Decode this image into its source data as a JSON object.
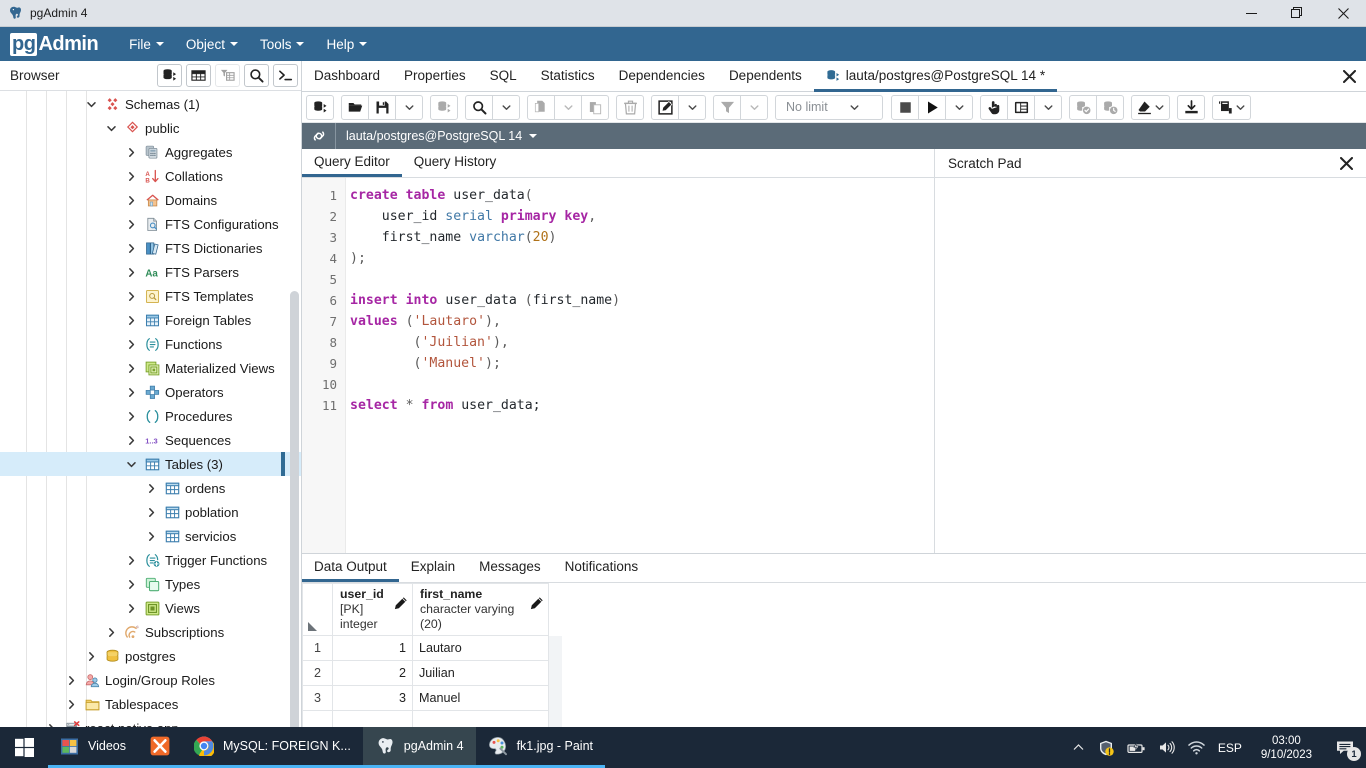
{
  "window": {
    "title": "pgAdmin 4",
    "icon": "pgadmin-elephant-icon",
    "minimize": "—",
    "restore": "❐",
    "close": "✕"
  },
  "menubar": {
    "brand_pg": "pg",
    "brand_admin": "Admin",
    "items": [
      {
        "label": "File"
      },
      {
        "label": "Object"
      },
      {
        "label": "Tools"
      },
      {
        "label": "Help"
      }
    ]
  },
  "browser": {
    "title": "Browser",
    "buttons": [
      {
        "name": "query-tool-button",
        "icon": "query-tool-icon",
        "enabled": true
      },
      {
        "name": "view-data-button",
        "icon": "grid-icon",
        "enabled": true
      },
      {
        "name": "filtered-rows-button",
        "icon": "filter-grid-icon",
        "enabled": false
      },
      {
        "name": "search-objects-button",
        "icon": "search-icon",
        "enabled": true
      },
      {
        "name": "psql-tool-button",
        "icon": "terminal-icon",
        "enabled": true
      }
    ],
    "tree": [
      {
        "label": "Schemas (1)",
        "icon": "schemas-icon",
        "indent": 4,
        "state": "open",
        "selected": false
      },
      {
        "label": "public",
        "icon": "schema-icon",
        "indent": 5,
        "state": "open",
        "selected": false
      },
      {
        "label": "Aggregates",
        "icon": "aggregates-icon",
        "indent": 6,
        "state": "closed",
        "selected": false
      },
      {
        "label": "Collations",
        "icon": "collations-icon",
        "indent": 6,
        "state": "closed",
        "selected": false
      },
      {
        "label": "Domains",
        "icon": "domains-icon",
        "indent": 6,
        "state": "closed",
        "selected": false
      },
      {
        "label": "FTS Configurations",
        "icon": "fts-configurations-icon",
        "indent": 6,
        "state": "closed",
        "selected": false
      },
      {
        "label": "FTS Dictionaries",
        "icon": "fts-dictionaries-icon",
        "indent": 6,
        "state": "closed",
        "selected": false
      },
      {
        "label": "FTS Parsers",
        "icon": "fts-parsers-icon",
        "indent": 6,
        "state": "closed",
        "selected": false
      },
      {
        "label": "FTS Templates",
        "icon": "fts-templates-icon",
        "indent": 6,
        "state": "closed",
        "selected": false
      },
      {
        "label": "Foreign Tables",
        "icon": "foreign-tables-icon",
        "indent": 6,
        "state": "closed",
        "selected": false
      },
      {
        "label": "Functions",
        "icon": "functions-icon",
        "indent": 6,
        "state": "closed",
        "selected": false
      },
      {
        "label": "Materialized Views",
        "icon": "materialized-views-icon",
        "indent": 6,
        "state": "closed",
        "selected": false
      },
      {
        "label": "Operators",
        "icon": "operators-icon",
        "indent": 6,
        "state": "closed",
        "selected": false
      },
      {
        "label": "Procedures",
        "icon": "procedures-icon",
        "indent": 6,
        "state": "closed",
        "selected": false
      },
      {
        "label": "Sequences",
        "icon": "sequences-icon",
        "indent": 6,
        "state": "closed",
        "selected": false
      },
      {
        "label": "Tables (3)",
        "icon": "tables-icon",
        "indent": 6,
        "state": "open",
        "selected": true
      },
      {
        "label": "ordens",
        "icon": "table-icon",
        "indent": 7,
        "state": "closed",
        "selected": false
      },
      {
        "label": "poblation",
        "icon": "table-icon",
        "indent": 7,
        "state": "closed",
        "selected": false
      },
      {
        "label": "servicios",
        "icon": "table-icon",
        "indent": 7,
        "state": "closed",
        "selected": false
      },
      {
        "label": "Trigger Functions",
        "icon": "trigger-functions-icon",
        "indent": 6,
        "state": "closed",
        "selected": false
      },
      {
        "label": "Types",
        "icon": "types-icon",
        "indent": 6,
        "state": "closed",
        "selected": false
      },
      {
        "label": "Views",
        "icon": "views-icon",
        "indent": 6,
        "state": "closed",
        "selected": false
      },
      {
        "label": "Subscriptions",
        "icon": "subscriptions-icon",
        "indent": 5,
        "state": "closed",
        "selected": false
      },
      {
        "label": "postgres",
        "icon": "database-icon",
        "indent": 4,
        "state": "closed",
        "selected": false
      },
      {
        "label": "Login/Group Roles",
        "icon": "roles-icon",
        "indent": 3,
        "state": "closed",
        "selected": false
      },
      {
        "label": "Tablespaces",
        "icon": "tablespaces-icon",
        "indent": 3,
        "state": "closed",
        "selected": false
      },
      {
        "label": "react native app",
        "icon": "server-disconnected-icon",
        "indent": 2,
        "state": "closed",
        "selected": false
      }
    ]
  },
  "object_tabs": {
    "tabs": [
      {
        "label": "Dashboard",
        "active": false,
        "icon": null
      },
      {
        "label": "Properties",
        "active": false,
        "icon": null
      },
      {
        "label": "SQL",
        "active": false,
        "icon": null
      },
      {
        "label": "Statistics",
        "active": false,
        "icon": null
      },
      {
        "label": "Dependencies",
        "active": false,
        "icon": null
      },
      {
        "label": "Dependents",
        "active": false,
        "icon": null
      },
      {
        "label": "lauta/postgres@PostgreSQL 14 *",
        "active": true,
        "icon": "database-tab-icon"
      }
    ],
    "close_icon": "close-icon"
  },
  "query_toolbar": {
    "groups": [
      {
        "buttons": [
          {
            "name": "open-query-tool-button",
            "icon": "query-tool-icon",
            "caret": false,
            "enabled": true
          }
        ]
      },
      {
        "buttons": [
          {
            "name": "open-file-button",
            "icon": "folder-open-icon",
            "caret": false,
            "enabled": true
          },
          {
            "name": "save-file-button",
            "icon": "save-icon",
            "caret": false,
            "enabled": true
          },
          {
            "name": "save-file-dropdown",
            "icon": null,
            "caret": true,
            "enabled": true
          }
        ]
      },
      {
        "buttons": [
          {
            "name": "view-data-button",
            "icon": "query-tool-icon",
            "caret": false,
            "enabled": false
          }
        ]
      },
      {
        "buttons": [
          {
            "name": "find-button",
            "icon": "search-icon",
            "caret": false,
            "enabled": true
          },
          {
            "name": "find-dropdown",
            "icon": null,
            "caret": true,
            "enabled": true
          }
        ]
      },
      {
        "buttons": [
          {
            "name": "copy-button",
            "icon": "copy-icon",
            "caret": false,
            "enabled": false
          },
          {
            "name": "copy-dropdown",
            "icon": null,
            "caret": true,
            "enabled": false
          },
          {
            "name": "paste-button",
            "icon": "paste-icon",
            "caret": false,
            "enabled": false
          }
        ]
      },
      {
        "buttons": [
          {
            "name": "delete-row-button",
            "icon": "trash-icon",
            "caret": false,
            "enabled": false
          }
        ]
      },
      {
        "buttons": [
          {
            "name": "edit-button",
            "icon": "edit-icon",
            "caret": false,
            "enabled": true
          },
          {
            "name": "edit-dropdown",
            "icon": null,
            "caret": true,
            "enabled": true
          }
        ]
      },
      {
        "buttons": [
          {
            "name": "filter-button",
            "icon": "funnel-icon",
            "caret": false,
            "enabled": false
          },
          {
            "name": "filter-dropdown",
            "icon": null,
            "caret": true,
            "enabled": false
          }
        ]
      }
    ],
    "limit": {
      "name": "row-limit-select",
      "value": "No limit"
    },
    "groups2": [
      {
        "buttons": [
          {
            "name": "stop-query-button",
            "icon": "stop-icon",
            "caret": false,
            "enabled": true
          },
          {
            "name": "execute-query-button",
            "icon": "play-icon",
            "caret": false,
            "enabled": true
          },
          {
            "name": "execute-dropdown",
            "icon": null,
            "caret": true,
            "enabled": true
          }
        ]
      },
      {
        "buttons": [
          {
            "name": "explain-button",
            "icon": "hand-pointer-icon",
            "caret": false,
            "enabled": true
          },
          {
            "name": "explain-analyze-button",
            "icon": "explain-panel-icon",
            "caret": false,
            "enabled": true
          },
          {
            "name": "explain-options-dropdown",
            "icon": null,
            "caret": true,
            "enabled": true
          }
        ]
      },
      {
        "buttons": [
          {
            "name": "commit-button",
            "icon": "commit-icon",
            "caret": false,
            "enabled": false
          },
          {
            "name": "rollback-button",
            "icon": "rollback-icon",
            "caret": false,
            "enabled": false
          }
        ]
      },
      {
        "buttons": [
          {
            "name": "clear-button",
            "icon": "eraser-icon",
            "caret": true,
            "enabled": true
          }
        ]
      },
      {
        "buttons": [
          {
            "name": "download-results-button",
            "icon": "download-icon",
            "caret": false,
            "enabled": true
          }
        ]
      },
      {
        "buttons": [
          {
            "name": "macros-button",
            "icon": "macro-icon",
            "caret": true,
            "enabled": true
          }
        ]
      }
    ]
  },
  "connection_bar": {
    "icon": "plug-icon",
    "label": "lauta/postgres@PostgreSQL 14",
    "caret": "⌄"
  },
  "editor": {
    "tabs": [
      {
        "label": "Query Editor",
        "active": true
      },
      {
        "label": "Query History",
        "active": false
      }
    ],
    "line_numbers": [
      "1",
      "2",
      "3",
      "4",
      "5",
      "6",
      "7",
      "8",
      "9",
      "10",
      "11"
    ],
    "sql_lines": [
      [
        {
          "t": "create",
          "c": "k"
        },
        {
          "t": " ",
          "c": "pu"
        },
        {
          "t": "table",
          "c": "k"
        },
        {
          "t": " ",
          "c": "pu"
        },
        {
          "t": "user_data",
          "c": "nm"
        },
        {
          "t": "(",
          "c": "pu"
        }
      ],
      [
        {
          "t": "    ",
          "c": "pu"
        },
        {
          "t": "user_id",
          "c": "nm"
        },
        {
          "t": " ",
          "c": "pu"
        },
        {
          "t": "serial",
          "c": "ty"
        },
        {
          "t": " ",
          "c": "pu"
        },
        {
          "t": "primary",
          "c": "k"
        },
        {
          "t": " ",
          "c": "pu"
        },
        {
          "t": "key",
          "c": "k"
        },
        {
          "t": ",",
          "c": "pu"
        }
      ],
      [
        {
          "t": "    ",
          "c": "pu"
        },
        {
          "t": "first_name",
          "c": "nm"
        },
        {
          "t": " ",
          "c": "pu"
        },
        {
          "t": "varchar",
          "c": "ty"
        },
        {
          "t": "(",
          "c": "pu"
        },
        {
          "t": "20",
          "c": "nu"
        },
        {
          "t": ")",
          "c": "pu"
        }
      ],
      [
        {
          "t": ");",
          "c": "pu"
        }
      ],
      [],
      [
        {
          "t": "insert",
          "c": "k"
        },
        {
          "t": " ",
          "c": "pu"
        },
        {
          "t": "into",
          "c": "k"
        },
        {
          "t": " ",
          "c": "pu"
        },
        {
          "t": "user_data",
          "c": "nm"
        },
        {
          "t": " ",
          "c": "pu"
        },
        {
          "t": "(",
          "c": "pu"
        },
        {
          "t": "first_name",
          "c": "nm"
        },
        {
          "t": ")",
          "c": "pu"
        }
      ],
      [
        {
          "t": "values",
          "c": "k"
        },
        {
          "t": " ",
          "c": "pu"
        },
        {
          "t": "(",
          "c": "pu"
        },
        {
          "t": "'Lautaro'",
          "c": "st"
        },
        {
          "t": "),",
          "c": "pu"
        }
      ],
      [
        {
          "t": "        ",
          "c": "pu"
        },
        {
          "t": "(",
          "c": "pu"
        },
        {
          "t": "'Juilian'",
          "c": "st"
        },
        {
          "t": "),",
          "c": "pu"
        }
      ],
      [
        {
          "t": "        ",
          "c": "pu"
        },
        {
          "t": "(",
          "c": "pu"
        },
        {
          "t": "'Manuel'",
          "c": "st"
        },
        {
          "t": ");",
          "c": "pu"
        }
      ],
      [],
      [
        {
          "t": "select",
          "c": "k"
        },
        {
          "t": " ",
          "c": "pu"
        },
        {
          "t": "*",
          "c": "pu"
        },
        {
          "t": " ",
          "c": "pu"
        },
        {
          "t": "from",
          "c": "k"
        },
        {
          "t": " ",
          "c": "pu"
        },
        {
          "t": "user_data;",
          "c": "nm"
        }
      ]
    ]
  },
  "scratch_pad": {
    "title": "Scratch Pad",
    "value": "",
    "close_icon": "close-icon"
  },
  "results": {
    "tabs": [
      {
        "label": "Data Output",
        "active": true
      },
      {
        "label": "Explain",
        "active": false
      },
      {
        "label": "Messages",
        "active": false
      },
      {
        "label": "Notifications",
        "active": false
      }
    ],
    "columns": [
      {
        "name": "user_id",
        "type": "[PK] integer",
        "edit_icon": "pencil-icon"
      },
      {
        "name": "first_name",
        "type": "character varying (20)",
        "edit_icon": "pencil-icon"
      }
    ],
    "rows": [
      {
        "num": "1",
        "user_id": "1",
        "first_name": "Lautaro"
      },
      {
        "num": "2",
        "user_id": "2",
        "first_name": "Juilian"
      },
      {
        "num": "3",
        "user_id": "3",
        "first_name": "Manuel"
      }
    ]
  },
  "taskbar": {
    "start_icon": "windows-start-icon",
    "items": [
      {
        "label": "Videos",
        "icon": "videos-icon",
        "running": true,
        "active": false
      },
      {
        "label": "",
        "icon": "xampp-icon",
        "running": true,
        "active": false
      },
      {
        "label": "MySQL: FOREIGN K...",
        "icon": "chrome-icon",
        "running": true,
        "active": false
      },
      {
        "label": "pgAdmin 4",
        "icon": "pgadmin-elephant-icon",
        "running": true,
        "active": true
      },
      {
        "label": "fk1.jpg - Paint",
        "icon": "paint-icon",
        "running": true,
        "active": false
      }
    ],
    "tray": [
      {
        "name": "show-hidden-icons",
        "icon": "chevron-up-icon"
      },
      {
        "name": "security-icon",
        "icon": "shield-warning-icon"
      },
      {
        "name": "battery-icon",
        "icon": "battery-icon"
      },
      {
        "name": "volume-icon",
        "icon": "speaker-icon"
      },
      {
        "name": "network-icon",
        "icon": "wifi-icon"
      }
    ],
    "language": "ESP",
    "time": "03:00",
    "date": "9/10/2023",
    "notification_icon": "notification-icon",
    "notification_count": "1"
  },
  "colors": {
    "brand_blue": "#326690",
    "connbar_gray": "#5b6b78",
    "selection_blue": "#d6ecfa",
    "taskbar": "#1b2838",
    "titlebar": "#dfe3e8",
    "keyword": "#a626a4",
    "string": "#b2553c",
    "number": "#b07219",
    "type": "#4078a6"
  }
}
